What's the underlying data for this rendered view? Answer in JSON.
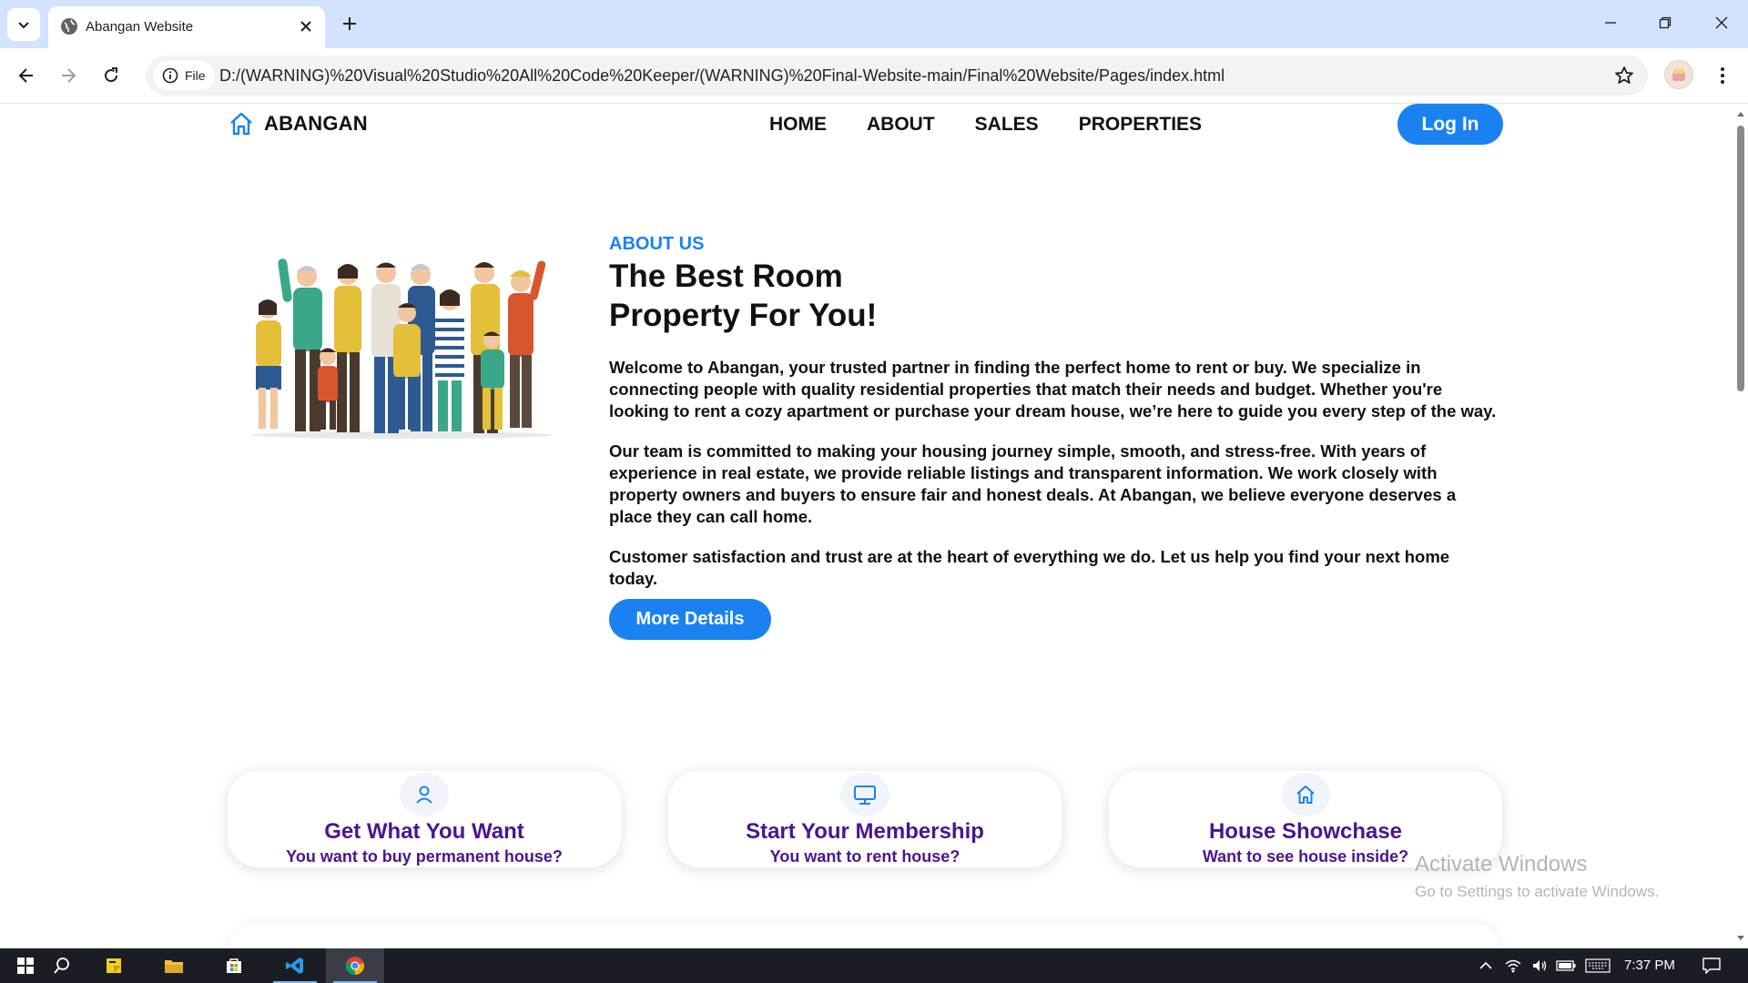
{
  "browser": {
    "tab_title": "Abangan Website",
    "chip_label": "File",
    "url": "D:/(WARNING)%20Visual%20Studio%20All%20Code%20Keeper/(WARNING)%20Final-Website-main/Final%20Website/Pages/index.html"
  },
  "site": {
    "brand": "ABANGAN",
    "nav": [
      "HOME",
      "ABOUT",
      "SALES",
      "PROPERTIES"
    ],
    "login_label": "Log In",
    "accent_color": "#1a82f0",
    "card_text_color": "#4b1590"
  },
  "about": {
    "eyebrow": "ABOUT US",
    "headline_line1": "The Best Room",
    "headline_line2": "Property For You!",
    "paragraphs": [
      "Welcome to Abangan, your trusted partner in finding the perfect home to rent or buy. We specialize in connecting people with quality residential properties that match their needs and budget. Whether you're looking to rent a cozy apartment or purchase your dream house, we’re here to guide you every step of the way.",
      "Our team is committed to making your housing journey simple, smooth, and stress-free. With years of experience in real estate, we provide reliable listings and transparent information. We work closely with property owners and buyers to ensure fair and honest deals. At Abangan, we believe everyone deserves a place they can call home.",
      "Customer satisfaction and trust are at the heart of everything we do. Let us help you find your next home today."
    ],
    "button_label": "More Details"
  },
  "cards": [
    {
      "icon": "user-icon",
      "title": "Get What You Want",
      "subtitle": "You want to buy permanent house?"
    },
    {
      "icon": "monitor-icon",
      "title": "Start Your Membership",
      "subtitle": "You want to rent house?"
    },
    {
      "icon": "home-icon",
      "title": "House Showchase",
      "subtitle": "Want to see house inside?"
    }
  ],
  "watermark": {
    "line1": "Activate Windows",
    "line2": "Go to Settings to activate Windows."
  },
  "taskbar": {
    "clock": "7:37 PM"
  }
}
